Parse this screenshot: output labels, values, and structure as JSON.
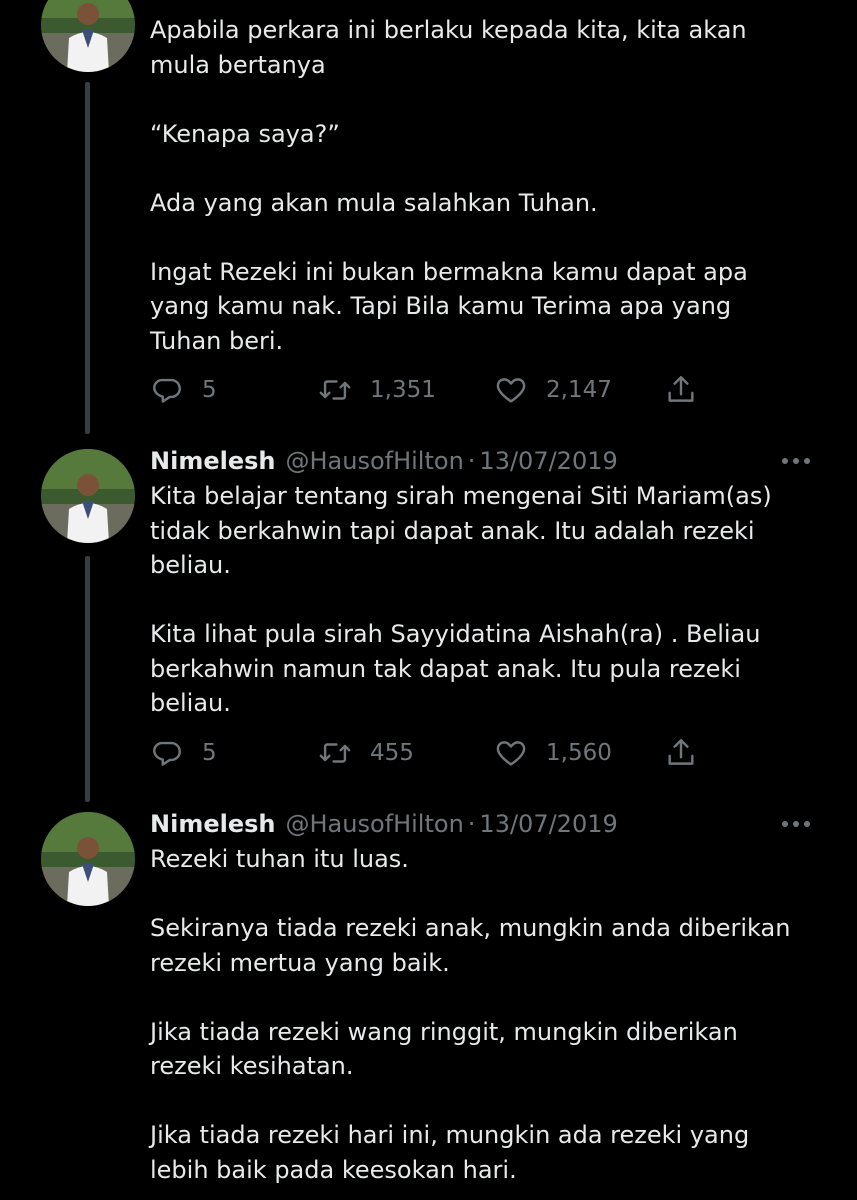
{
  "tweets": [
    {
      "name": "",
      "handle": "",
      "date": "",
      "text": "Apabila perkara ini berlaku kepada kita, kita akan\nmula bertanya\n\n“Kenapa saya?”\n\nAda yang akan mula salahkan Tuhan.\n\nIngat Rezeki ini bukan bermakna kamu dapat apa\nyang kamu nak. Tapi Bila kamu Terima apa yang\nTuhan beri.",
      "replies": "5",
      "retweets": "1,351",
      "likes": "2,147"
    },
    {
      "name": "Nimelesh",
      "handle": "@HausofHilton",
      "date": "13/07/2019",
      "text": "Kita belajar tentang sirah mengenai Siti Mariam(as)\ntidak berkahwin tapi dapat anak. Itu adalah rezeki\nbeliau.\n\nKita lihat pula sirah Sayyidatina Aishah(ra) . Beliau\nberkahwin namun tak dapat anak. Itu pula rezeki\nbeliau.",
      "replies": "5",
      "retweets": "455",
      "likes": "1,560"
    },
    {
      "name": "Nimelesh",
      "handle": "@HausofHilton",
      "date": "13/07/2019",
      "text": "Rezeki tuhan itu luas.\n\nSekiranya tiada rezeki anak, mungkin anda diberikan\nrezeki mertua yang baik.\n\nJika tiada rezeki wang ringgit, mungkin diberikan\nrezeki kesihatan.\n\nJika tiada rezeki hari ini, mungkin ada rezeki yang\nlebih baik pada keesokan hari."
    }
  ],
  "separator": "·",
  "icons": {
    "reply": "reply-icon",
    "retweet": "retweet-icon",
    "like": "heart-icon",
    "share": "share-icon",
    "more": "more-icon"
  },
  "colors": {
    "background": "#000000",
    "text": "#e7e9ea",
    "muted": "#71767b",
    "thread": "#3a3d40"
  }
}
